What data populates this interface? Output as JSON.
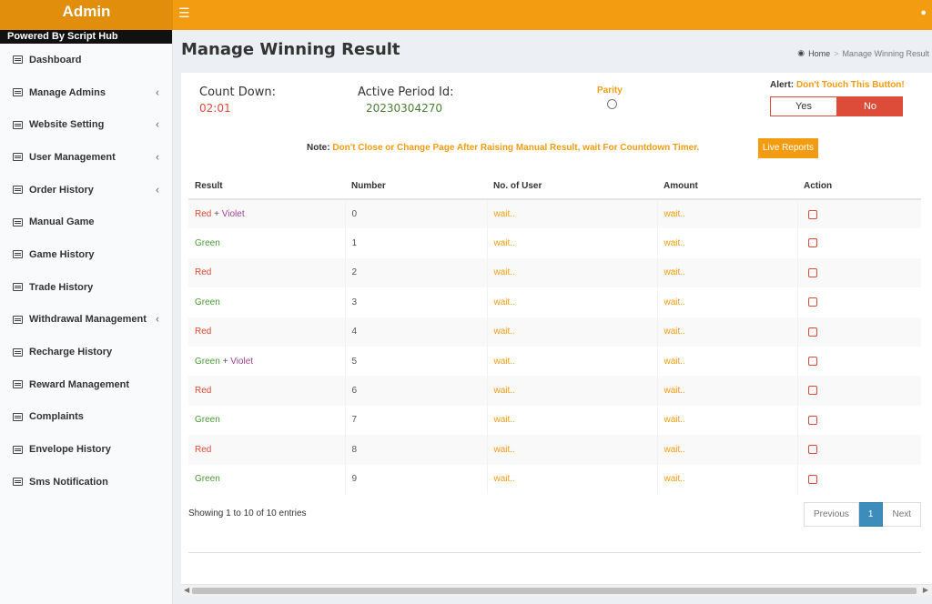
{
  "app": {
    "title": "Admin",
    "powered_by": "Powered By Script Hub",
    "menu_icon": "hamburger-icon",
    "user_icon": "user-icon"
  },
  "sidebar": {
    "items": [
      {
        "label": "Dashboard",
        "has_submenu": false
      },
      {
        "label": "Manage Admins",
        "has_submenu": true
      },
      {
        "label": "Website Setting",
        "has_submenu": true
      },
      {
        "label": "User Management",
        "has_submenu": true
      },
      {
        "label": "Order History",
        "has_submenu": true
      },
      {
        "label": "Manual Game",
        "has_submenu": false
      },
      {
        "label": "Game History",
        "has_submenu": false
      },
      {
        "label": "Trade History",
        "has_submenu": false
      },
      {
        "label": "Withdrawal Management",
        "has_submenu": true
      },
      {
        "label": "Recharge History",
        "has_submenu": false
      },
      {
        "label": "Reward Management",
        "has_submenu": false
      },
      {
        "label": "Complaints",
        "has_submenu": false
      },
      {
        "label": "Envelope History",
        "has_submenu": false
      },
      {
        "label": "Sms Notification",
        "has_submenu": false
      }
    ]
  },
  "header": {
    "page_title": "Manage Winning Result",
    "breadcrumb": {
      "home": "Home",
      "separator": ">",
      "current": "Manage Winning Result"
    }
  },
  "panel": {
    "countdown_label": "Count Down:",
    "countdown_value": "02:01",
    "period_label": "Active Period Id:",
    "period_value": "20230304270",
    "parity_label": "Parity",
    "alert_label": "Alert:",
    "alert_text": "Don't Touch This Button!",
    "yes_label": "Yes",
    "no_label": "No",
    "note_label": "Note:",
    "note_text": "Don't Close or Change Page After Raising Manual Result, wait For Countdown Timer.",
    "live_reports_label": "Live Reports"
  },
  "table": {
    "headers": [
      "Result",
      "Number",
      "No. of User",
      "Amount",
      "Action"
    ],
    "rows": [
      {
        "result": [
          {
            "t": "Red",
            "c": "r"
          },
          {
            "t": " + ",
            "c": "plus"
          },
          {
            "t": "Violet",
            "c": "v"
          }
        ],
        "number": "0",
        "users": "wait..",
        "amount": "wait.."
      },
      {
        "result": [
          {
            "t": "Green",
            "c": "g"
          }
        ],
        "number": "1",
        "users": "wait..",
        "amount": "wait.."
      },
      {
        "result": [
          {
            "t": "Red",
            "c": "r"
          }
        ],
        "number": "2",
        "users": "wait..",
        "amount": "wait.."
      },
      {
        "result": [
          {
            "t": "Green",
            "c": "g"
          }
        ],
        "number": "3",
        "users": "wait..",
        "amount": "wait.."
      },
      {
        "result": [
          {
            "t": "Red",
            "c": "r"
          }
        ],
        "number": "4",
        "users": "wait..",
        "amount": "wait.."
      },
      {
        "result": [
          {
            "t": "Green",
            "c": "g"
          },
          {
            "t": " + ",
            "c": "plus"
          },
          {
            "t": "Violet",
            "c": "v"
          }
        ],
        "number": "5",
        "users": "wait..",
        "amount": "wait.."
      },
      {
        "result": [
          {
            "t": "Red",
            "c": "r"
          }
        ],
        "number": "6",
        "users": "wait..",
        "amount": "wait.."
      },
      {
        "result": [
          {
            "t": "Green",
            "c": "g"
          }
        ],
        "number": "7",
        "users": "wait..",
        "amount": "wait.."
      },
      {
        "result": [
          {
            "t": "Red",
            "c": "r"
          }
        ],
        "number": "8",
        "users": "wait..",
        "amount": "wait.."
      },
      {
        "result": [
          {
            "t": "Green",
            "c": "g"
          }
        ],
        "number": "9",
        "users": "wait..",
        "amount": "wait.."
      }
    ]
  },
  "footer": {
    "showing": "Showing 1 to 10 of 10 entries",
    "pager": {
      "previous": "Previous",
      "current": "1",
      "next": "Next"
    }
  },
  "colors": {
    "accent": "#f39c12",
    "danger": "#dd4b39",
    "primary": "#3c8dbc",
    "green": "#4a9a36",
    "violet": "#a0468f"
  }
}
